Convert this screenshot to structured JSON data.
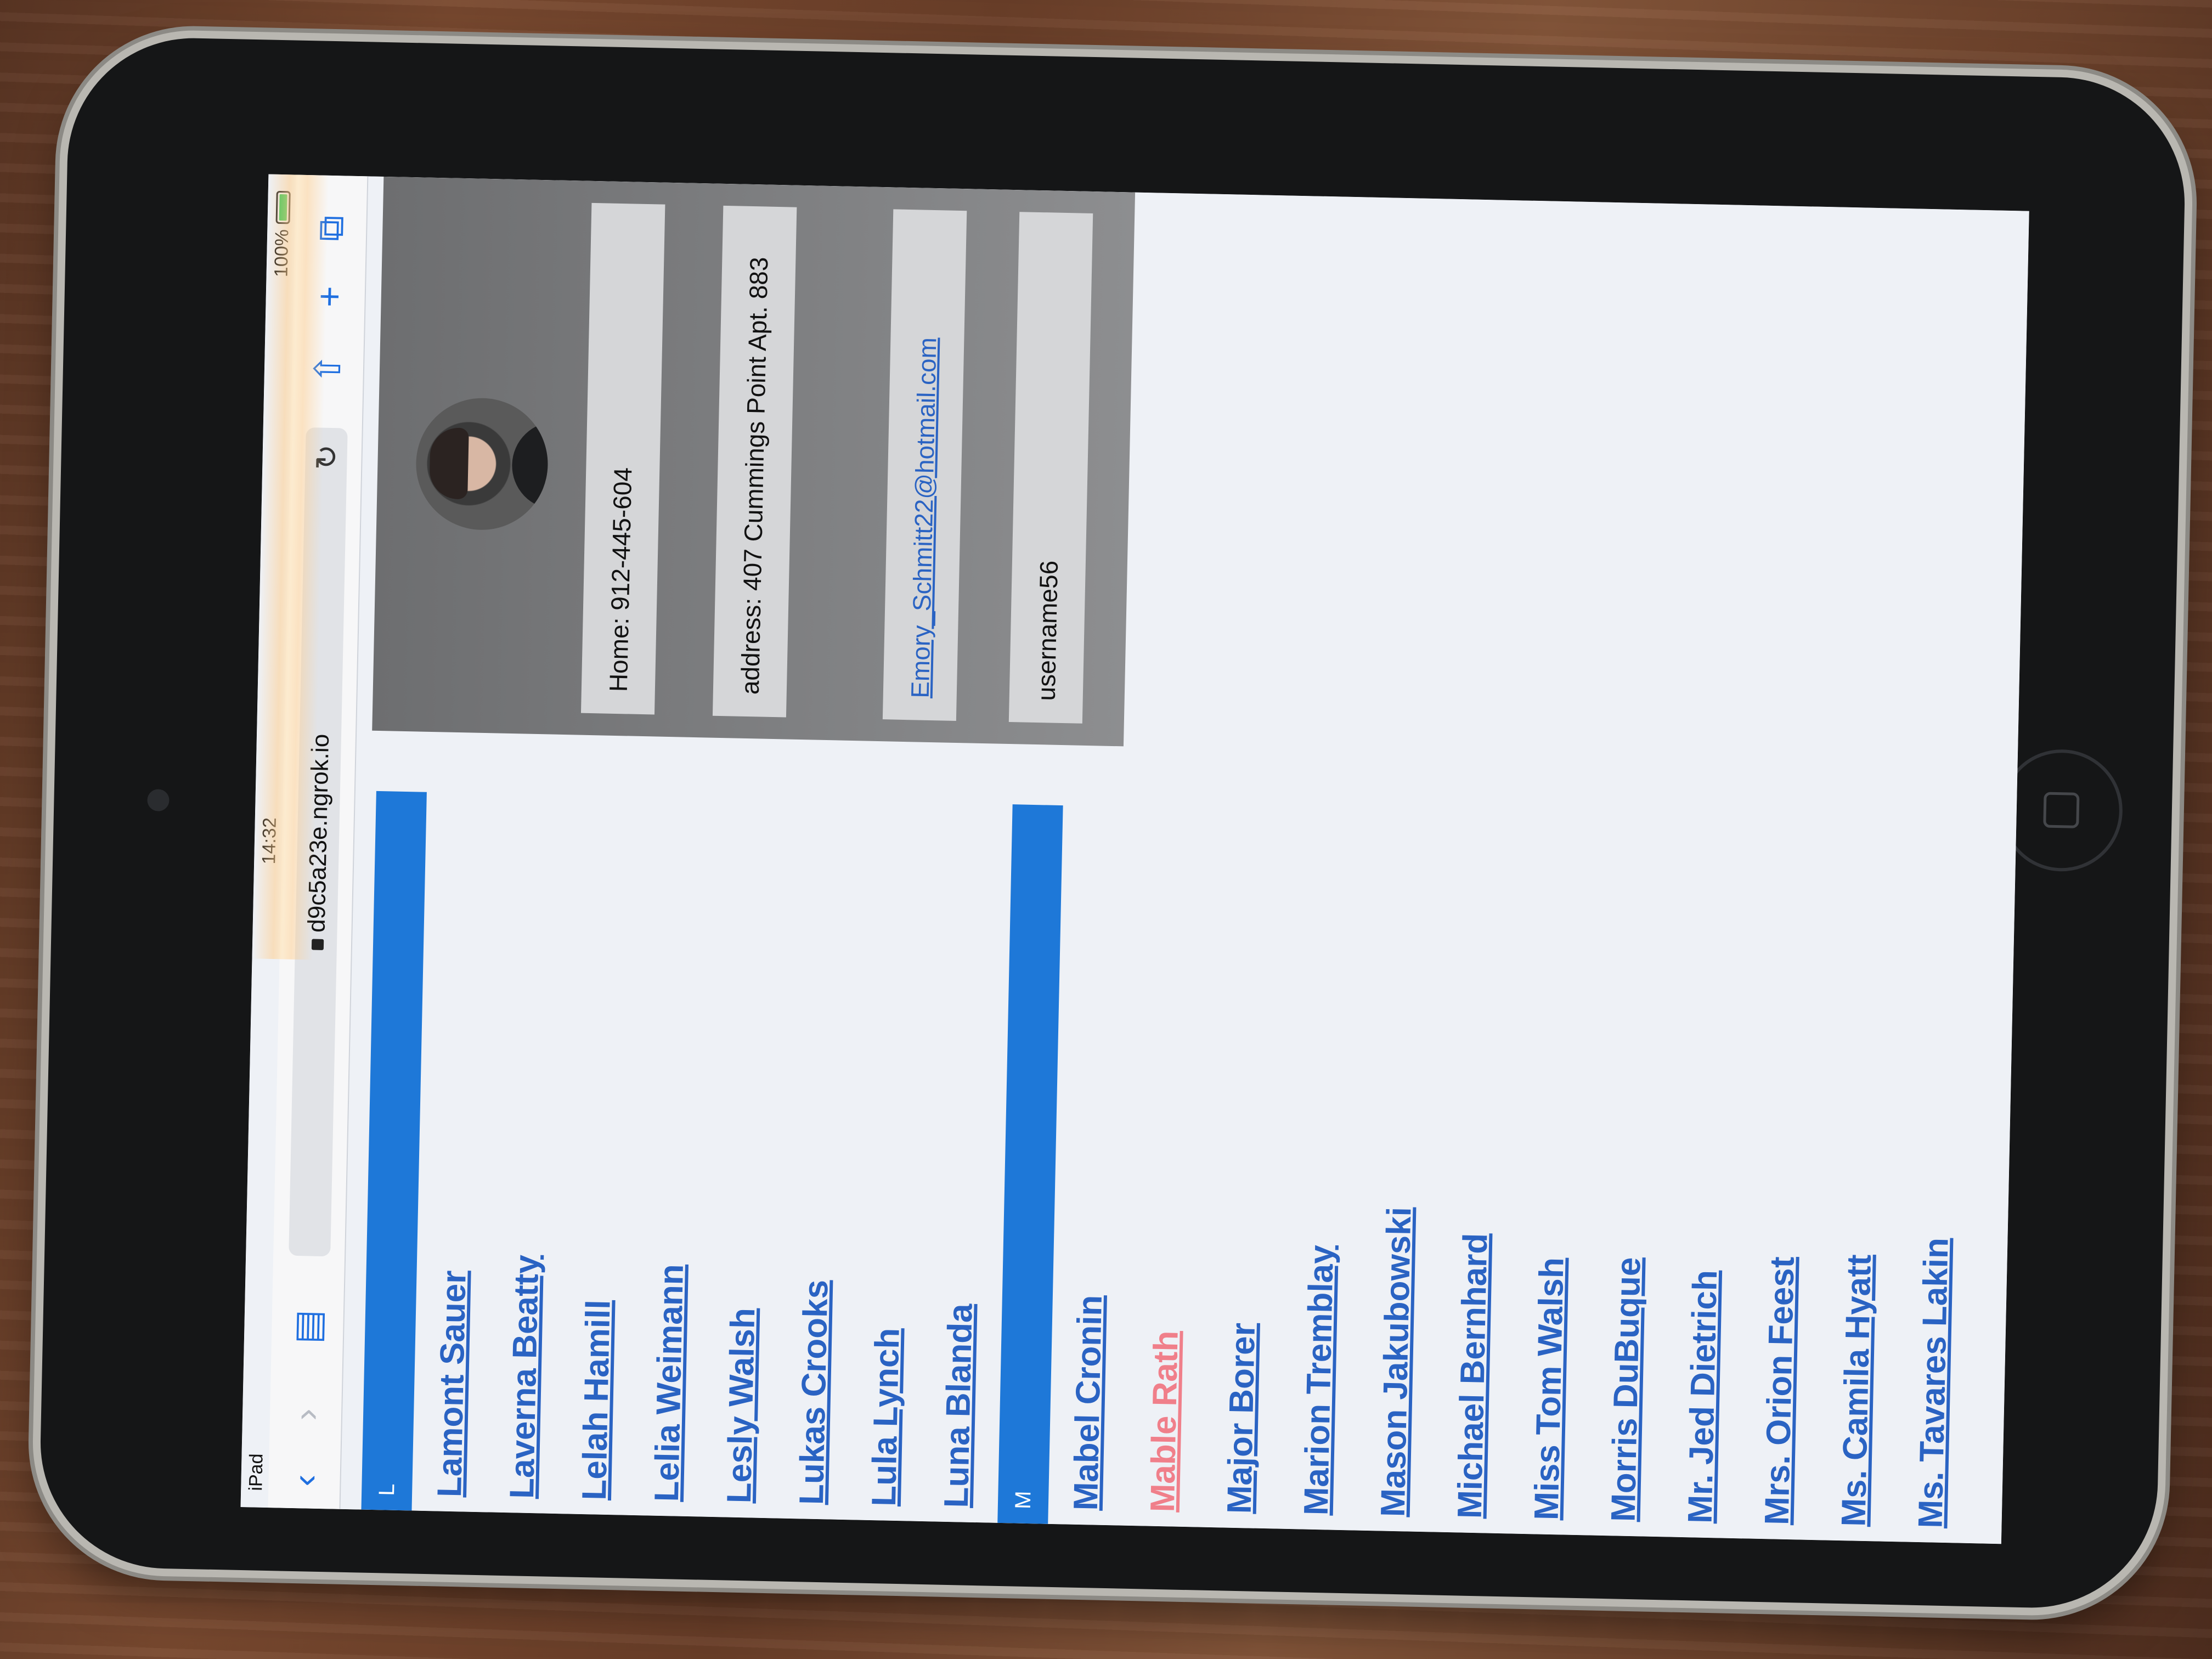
{
  "status_bar": {
    "device": "iPad",
    "time": "14:32",
    "battery": "100%"
  },
  "browser": {
    "url": "d9c5a23e.ngrok.io"
  },
  "sections": [
    {
      "letter": "L",
      "contacts": [
        "Lamont Sauer",
        "Laverna Beatty",
        "Lelah Hamill",
        "Lelia Weimann",
        "Lesly Walsh",
        "Lukas Crooks",
        "Lula Lynch",
        "Luna Blanda"
      ]
    },
    {
      "letter": "M",
      "contacts": [
        "Mabel Cronin",
        "Mable Rath",
        "Major Borer",
        "Marion Tremblay",
        "Mason Jakubowski",
        "Michael Bernhard",
        "Miss Tom Walsh",
        "Morris DuBuque",
        "Mr. Jed Dietrich",
        "Mrs. Orion Feest",
        "Ms. Camila Hyatt",
        "Ms. Tavares Lakin"
      ]
    }
  ],
  "detail": {
    "phone": "Home: 912-445-604",
    "address": "address: 407 Cummings Point Apt. 883",
    "email": "Emory_Schmitt22@hotmail.com",
    "username": "username56"
  },
  "colors": {
    "section_header": "#1e78d8",
    "link": "#2a63c3",
    "visited_link": "#f07f8a",
    "card": "#7a7b7d"
  },
  "icons": {
    "back": "chevron-left-icon",
    "forward": "chevron-right-icon",
    "bookmarks": "book-icon",
    "share": "share-icon",
    "new_tab": "plus-icon",
    "tabs": "tabs-icon",
    "reload": "reload-icon"
  }
}
